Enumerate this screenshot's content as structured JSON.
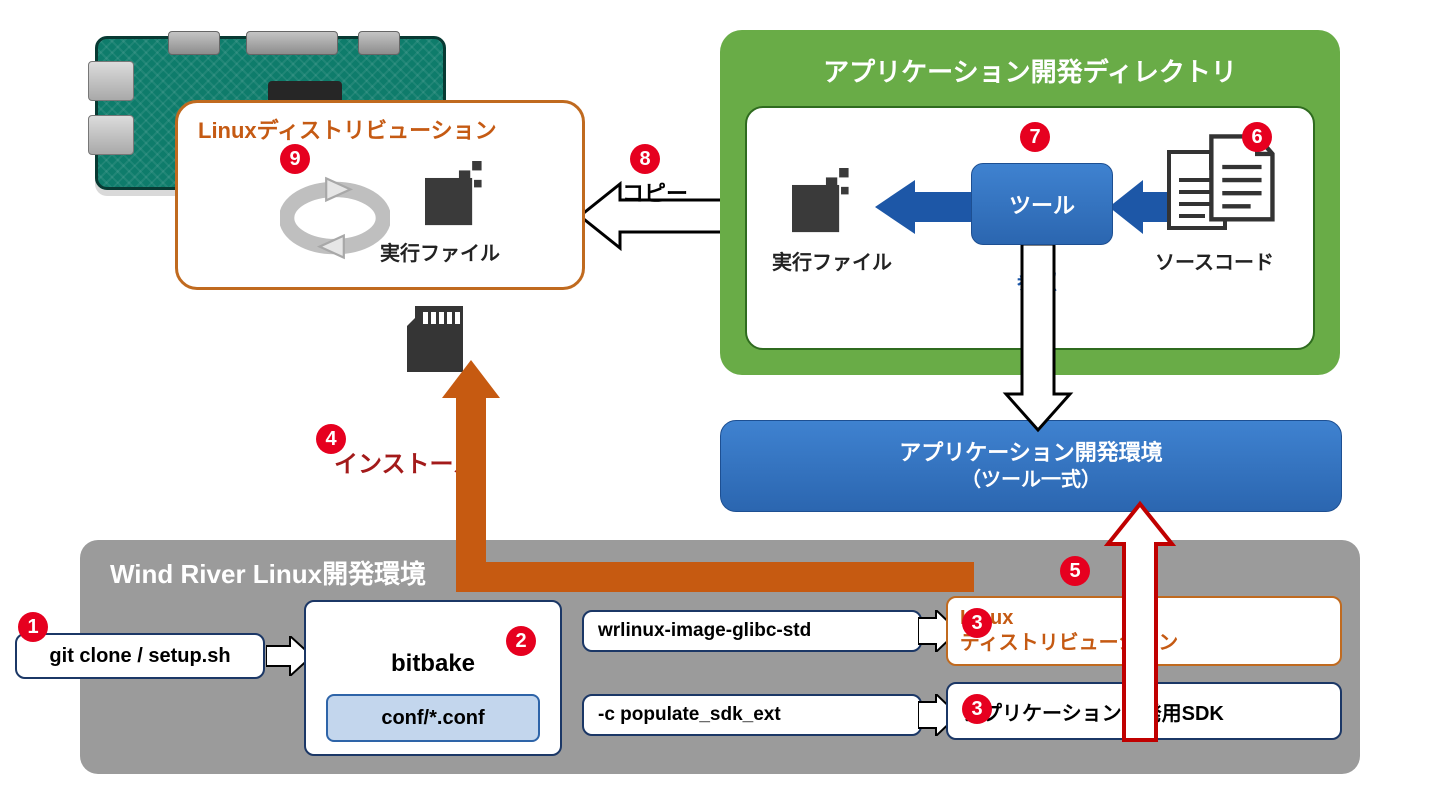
{
  "distro": {
    "title": "Linuxディストリビューション",
    "exec_label": "実行ファイル"
  },
  "app_dir": {
    "title": "アプリケーション開発ディレクトリ",
    "exec_label": "実行ファイル",
    "tool_label": "ツール",
    "ref_label": "参照",
    "src_label": "ソースコード"
  },
  "env_box": {
    "line1": "アプリケーション開発環境",
    "line2": "（ツール一式）"
  },
  "dev_env": {
    "title": "Wind River Linux開発環境",
    "git": "git clone / setup.sh",
    "bitbake": "bitbake",
    "conf": "conf/*.conf",
    "cmd1": "wrlinux-image-glibc-std",
    "cmd2": "-c populate_sdk_ext",
    "out1a": "Linux",
    "out1b": "ディストリビューション",
    "out2": "アプリケーション開発用SDK"
  },
  "labels": {
    "install": "インストール",
    "copy": "コピー"
  },
  "badges": {
    "b1": "1",
    "b2": "2",
    "b3": "3",
    "b4": "4",
    "b5": "5",
    "b6": "6",
    "b7": "7",
    "b8": "8",
    "b9": "9"
  }
}
